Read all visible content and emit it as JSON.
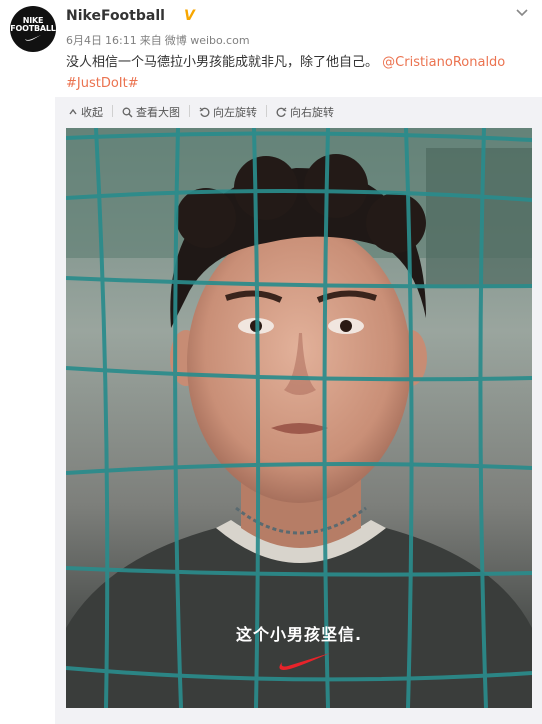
{
  "post": {
    "avatar": {
      "line1": "NIKE",
      "line2": "FOOTBALL"
    },
    "username": "NikeFootball",
    "verified_badge": "V",
    "date": "6月4日",
    "time": "16:11",
    "source_prefix": "来自",
    "source": "微博 weibo.com",
    "text_main": "没人相信一个马德拉小男孩能成就非凡，除了他自己。",
    "mention": "@CristianoRonaldo",
    "hashtag": "#JustDoIt#"
  },
  "toolbar": {
    "collapse": "收起",
    "view_large": "查看大图",
    "rotate_left": "向左旋转",
    "rotate_right": "向右旋转"
  },
  "image": {
    "caption": "这个小男孩坚信."
  },
  "colors": {
    "link": "#eb7350",
    "verified": "#f7a600",
    "swoosh": "#e8232a",
    "net": "#2a8c8c"
  },
  "icons": [
    "more-chevron-icon",
    "collapse-arrow-icon",
    "search-icon",
    "rotate-left-icon",
    "rotate-right-icon",
    "nike-swoosh-icon"
  ]
}
